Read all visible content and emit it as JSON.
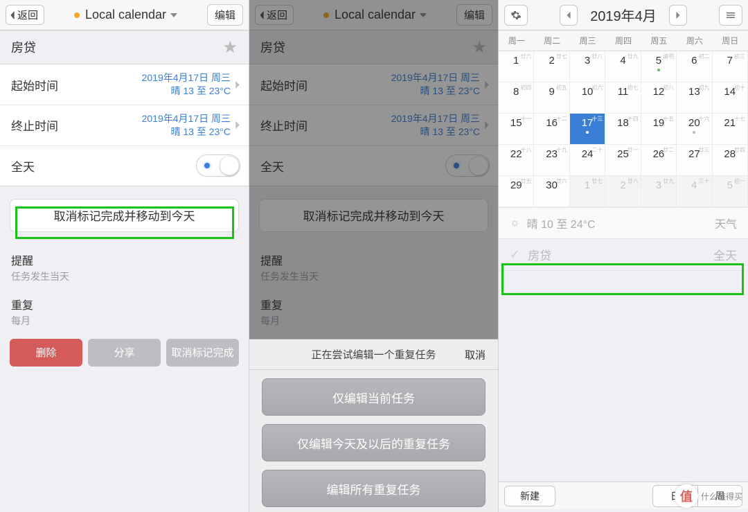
{
  "panel1": {
    "back": "返回",
    "title": "Local calendar",
    "edit": "编辑",
    "task_name": "房贷",
    "start_label": "起始时间",
    "end_label": "终止时间",
    "start_date": "2019年4月17日 周三",
    "start_weather": "晴 13 至 23°C",
    "end_date": "2019年4月17日 周三",
    "end_weather": "晴 13 至 23°C",
    "allday": "全天",
    "action": "取消标记完成并移动到今天",
    "reminder_label": "提醒",
    "reminder_value": "任务发生当天",
    "repeat_label": "重复",
    "repeat_value": "每月",
    "delete": "删除",
    "share": "分享",
    "unmark": "取消标记完成"
  },
  "panel2": {
    "sheet_title": "正在尝试编辑一个重复任务",
    "cancel": "取消",
    "opt1": "仅编辑当前任务",
    "opt2": "仅编辑今天及以后的重复任务",
    "opt3": "编辑所有重复任务"
  },
  "panel3": {
    "month": "2019年4月",
    "weekdays": [
      "周一",
      "周二",
      "周三",
      "周四",
      "周五",
      "周六",
      "周日"
    ],
    "lunar_header_hints": [
      "廿六",
      "廿七",
      "廿八",
      "廿九",
      "清明",
      "初二",
      "初三"
    ],
    "grid": [
      {
        "d": "1",
        "l": "廿六"
      },
      {
        "d": "2",
        "l": "廿七"
      },
      {
        "d": "3",
        "l": "廿八"
      },
      {
        "d": "4",
        "l": "廿九"
      },
      {
        "d": "5",
        "l": "清明",
        "dot": "#69b96b"
      },
      {
        "d": "6",
        "l": "初二"
      },
      {
        "d": "7",
        "l": "初三"
      },
      {
        "d": "8",
        "l": "初四"
      },
      {
        "d": "9",
        "l": "初五"
      },
      {
        "d": "10",
        "l": "初六"
      },
      {
        "d": "11",
        "l": "初七"
      },
      {
        "d": "12",
        "l": "初八"
      },
      {
        "d": "13",
        "l": "初九"
      },
      {
        "d": "14",
        "l": "初十"
      },
      {
        "d": "15",
        "l": "十一"
      },
      {
        "d": "16",
        "l": "十二"
      },
      {
        "d": "17",
        "l": "十三",
        "today": true,
        "dot": "#fff"
      },
      {
        "d": "18",
        "l": "十四"
      },
      {
        "d": "19",
        "l": "十五"
      },
      {
        "d": "20",
        "l": "十六",
        "dot": "#bbb"
      },
      {
        "d": "21",
        "l": "十七"
      },
      {
        "d": "22",
        "l": "十八"
      },
      {
        "d": "23",
        "l": "十九"
      },
      {
        "d": "24",
        "l": "二十"
      },
      {
        "d": "25",
        "l": "廿一"
      },
      {
        "d": "26",
        "l": "廿二"
      },
      {
        "d": "27",
        "l": "廿三"
      },
      {
        "d": "28",
        "l": "廿四"
      },
      {
        "d": "29",
        "l": "廿五"
      },
      {
        "d": "30",
        "l": "廿六"
      },
      {
        "d": "1",
        "l": "廿七",
        "other": true
      },
      {
        "d": "2",
        "l": "廿八",
        "other": true
      },
      {
        "d": "3",
        "l": "廿九",
        "other": true
      },
      {
        "d": "4",
        "l": "三十",
        "other": true
      },
      {
        "d": "5",
        "l": "初一",
        "other": true
      }
    ],
    "weather_text": "晴 10 至 24°C",
    "weather_label": "天气",
    "event_name": "房贷",
    "event_time": "全天",
    "new_btn": "新建",
    "seg_day": "日",
    "seg_week": "周"
  },
  "watermark_text": "什么值得买",
  "watermark_badge": "值"
}
